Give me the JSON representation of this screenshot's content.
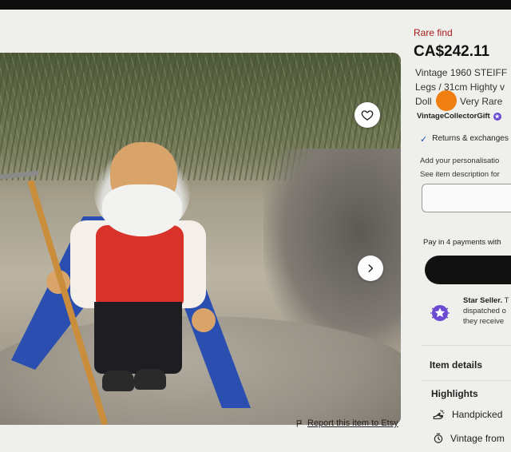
{
  "listing": {
    "badge": "Rare find",
    "price": "CA$242.11",
    "title_lines": [
      "Vintage 1960 STEIFF",
      "Legs / 31cm Highty v",
      "Doll",
      "Very Rare"
    ],
    "shop_name": "VintageCollectorGift",
    "returns": "Returns & exchanges",
    "personalisation_label": "Add your personalisatio",
    "personalisation_hint": "See item description for",
    "pay_in_4": "Pay in 4 payments with",
    "star_seller_title": "Star Seller.",
    "star_seller_lines": [
      "T",
      "dispatched o",
      "they receive"
    ],
    "item_details": "Item details",
    "highlights": "Highlights",
    "highlight_items": [
      "Handpicked",
      "Vintage from"
    ]
  },
  "gallery": {
    "report_link": "Report this item to Etsy"
  },
  "icons": {
    "favorite": "heart-icon",
    "next": "chevron-right-icon",
    "flag": "flag-icon",
    "check": "check-icon",
    "star_seller": "star-badge-icon",
    "handpicked": "hand-icon",
    "vintage": "clock-icon"
  },
  "colors": {
    "rare_find": "#a61b1b",
    "orange_dot": "#f07f11",
    "star_seller_purple": "#6a4bd1"
  }
}
